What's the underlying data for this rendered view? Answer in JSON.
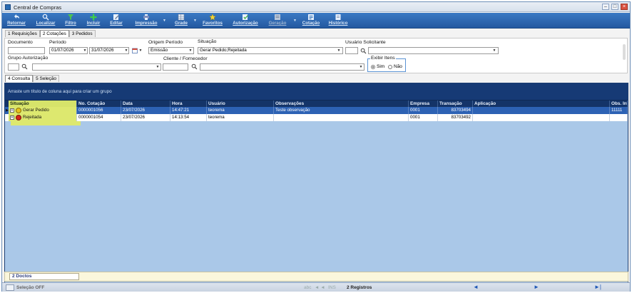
{
  "window": {
    "title": "Central de Compras"
  },
  "toolbar": {
    "items": [
      {
        "label": "Retornar",
        "icon": "return-icon"
      },
      {
        "label": "Localizar",
        "icon": "search-icon"
      },
      {
        "label": "Filtro",
        "icon": "filter-icon"
      },
      {
        "label": "Incluir",
        "icon": "add-icon"
      },
      {
        "label": "Editar",
        "icon": "edit-icon"
      },
      {
        "label": "Impressão",
        "icon": "print-icon"
      },
      {
        "label": "Grade",
        "icon": "grid-icon"
      },
      {
        "label": "Favoritos",
        "icon": "star-icon"
      },
      {
        "label": "Autorização",
        "icon": "authorize-icon"
      },
      {
        "label": "Geração",
        "icon": "generate-icon"
      },
      {
        "label": "Cotação",
        "icon": "quote-icon"
      },
      {
        "label": "Histórico",
        "icon": "history-icon"
      }
    ]
  },
  "tabs_top": [
    "1 Requisições",
    "2 Cotações",
    "3 Pedidos"
  ],
  "filters": {
    "documento_label": "Documento",
    "periodo_label": "Período",
    "periodo_inicio": "01/07/2026",
    "periodo_fim": "31/07/2026",
    "origem_label": "Origem Período",
    "origem_value": "Emissão",
    "situacao_label": "Situação",
    "situacao_value": "Gerar Pedido;Rejeitada",
    "usuario_label": "Usuário Solicitante",
    "grupo_label": "Grupo Autorização",
    "cliente_label": "Cliente / Fornecedor",
    "exibir_label": "Exibir Itens",
    "exibir_sim": "Sim",
    "exibir_nao": "Não"
  },
  "tabs_bottom": [
    "4 Consulta",
    "5 Seleção"
  ],
  "grid": {
    "group_hint": "Arraste um título de coluna aqui para criar um grupo",
    "columns": [
      "Situação",
      "No. Cotação",
      "Data",
      "Hora",
      "Usuário",
      "Observações",
      "Empresa",
      "Transação",
      "Aplicação",
      "Obs. Int"
    ],
    "rows": [
      {
        "situacao": "Gerar Pedido",
        "cotacao": "0000001056",
        "data": "23/07/2026",
        "hora": "14:47:21",
        "usuario": "teorema",
        "obs": "Teste observação",
        "empresa": "0001",
        "transacao": "83703494",
        "aplicacao": "",
        "obs_int": "11111"
      },
      {
        "situacao": "Rejeitada",
        "cotacao": "0000001054",
        "data": "23/07/2026",
        "hora": "14:13:54",
        "usuario": "teorema",
        "obs": "",
        "empresa": "0001",
        "transacao": "83703492",
        "aplicacao": "",
        "obs_int": ""
      }
    ],
    "footer_count": "2 Doctos"
  },
  "statusbar": {
    "selecao": "Seleção OFF",
    "abc": "abc",
    "ins": "INS",
    "registros": "2 Registros"
  }
}
